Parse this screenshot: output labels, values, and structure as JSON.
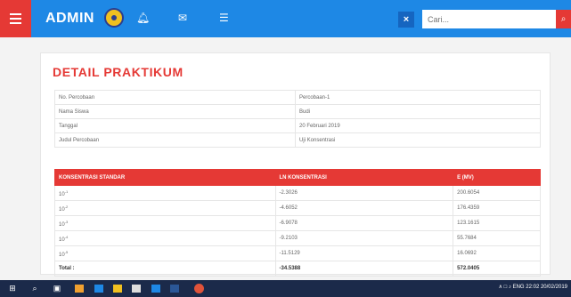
{
  "header": {
    "brand": "ADMIN",
    "search_placeholder": "Cari...",
    "clear_label": "×",
    "icons": [
      "menu-icon",
      "logo",
      "bell-icon",
      "mail-icon",
      "list-icon",
      "search-icon"
    ]
  },
  "page": {
    "title": "DETAIL PRAKTIKUM"
  },
  "info": [
    {
      "label": "No. Percobaan",
      "value": "Percobaan-1"
    },
    {
      "label": "Nama Siswa",
      "value": "Budi"
    },
    {
      "label": "Tanggal",
      "value": "20 Februari 2019"
    },
    {
      "label": "Judul Percobaan",
      "value": "Uji Konsentrasi"
    }
  ],
  "table": {
    "headers": [
      "KONSENTRASI STANDAR",
      "LN KONSENTRASI",
      "E (MV)"
    ],
    "rows": [
      {
        "base": "10",
        "exp": "-1",
        "ln": "-2.3026",
        "e": "200.6054"
      },
      {
        "base": "10",
        "exp": "-2",
        "ln": "-4.6052",
        "e": "176.4359"
      },
      {
        "base": "10",
        "exp": "-3",
        "ln": "-6.9078",
        "e": "123.1615"
      },
      {
        "base": "10",
        "exp": "-4",
        "ln": "-9.2103",
        "e": "55.7684"
      },
      {
        "base": "10",
        "exp": "-5",
        "ln": "-11.5129",
        "e": "16.0692"
      }
    ],
    "total": {
      "label": "Total :",
      "ln": "-34.5388",
      "e": "572.0405"
    }
  },
  "taskbar": {
    "tray_text": "ENG",
    "time": "22:02",
    "date": "20/02/2019"
  }
}
